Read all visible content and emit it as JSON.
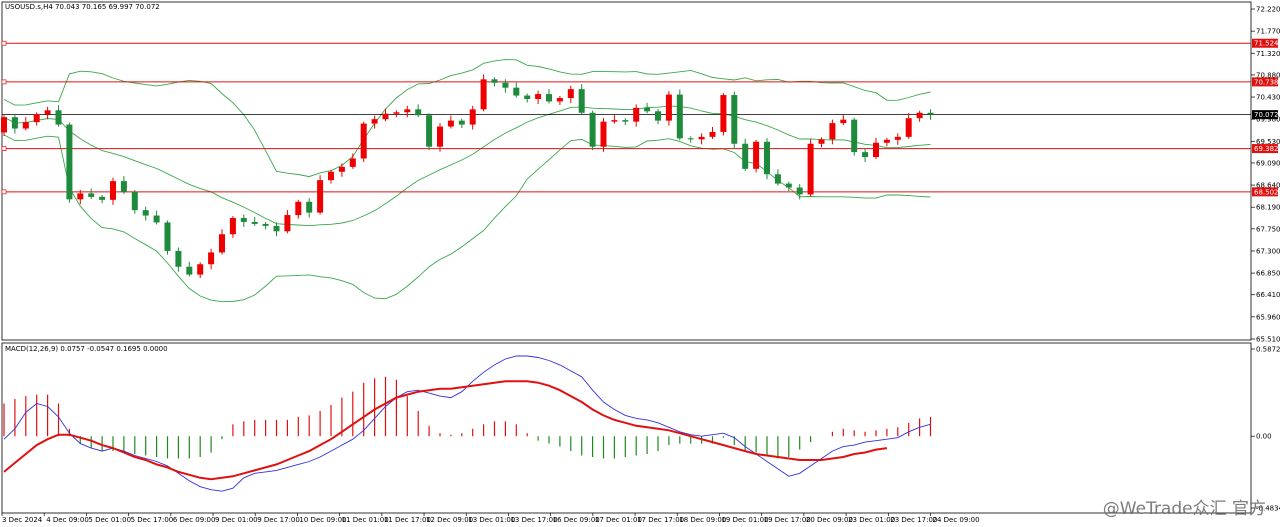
{
  "chart_data": {
    "type": "candlestick",
    "symbol_header": "USOUSD.s,H4  70.043 70.165 69.997 70.072",
    "price_axis_ticks": [
      "72.220",
      "71.770",
      "71.320",
      "70.880",
      "70.430",
      "69.980",
      "69.530",
      "69.090",
      "68.640",
      "68.190",
      "67.750",
      "67.300",
      "66.850",
      "66.410",
      "65.960",
      "65.510"
    ],
    "price_range": [
      65.51,
      72.22
    ],
    "current_price": {
      "label": "70.072",
      "value": 70.072
    },
    "horizontal_levels": [
      {
        "label": "71.524",
        "value": 71.524
      },
      {
        "label": "70.738",
        "value": 70.738
      },
      {
        "label": "69.382",
        "value": 69.382
      },
      {
        "label": "68.502",
        "value": 68.502
      }
    ],
    "time_labels": [
      "3 Dec 2024",
      "4 Dec 09:00",
      "5 Dec 01:00",
      "5 Dec 17:00",
      "6 Dec 09:00",
      "9 Dec 01:00",
      "9 Dec 17:00",
      "10 Dec 09:00",
      "11 Dec 01:00",
      "11 Dec 17:00",
      "12 Dec 09:00",
      "13 Dec 01:00",
      "13 Dec 17:00",
      "16 Dec 09:00",
      "17 Dec 01:00",
      "17 Dec 17:00",
      "18 Dec 09:00",
      "19 Dec 01:00",
      "19 Dec 17:00",
      "20 Dec 09:00",
      "23 Dec 01:00",
      "23 Dec 17:00",
      "24 Dec 09:00"
    ],
    "closes": [
      70.02,
      69.79,
      69.92,
      70.08,
      70.16,
      69.87,
      68.35,
      68.47,
      68.4,
      68.34,
      68.72,
      68.5,
      68.13,
      68.02,
      67.88,
      67.3,
      66.98,
      66.82,
      67.03,
      67.27,
      67.64,
      67.97,
      67.89,
      67.85,
      67.81,
      67.7,
      68.03,
      68.3,
      68.08,
      68.74,
      68.91,
      69.01,
      69.18,
      69.89,
      69.98,
      70.09,
      70.12,
      70.18,
      70.06,
      69.42,
      69.83,
      69.95,
      69.87,
      70.18,
      70.79,
      70.72,
      70.62,
      70.46,
      70.39,
      70.49,
      70.34,
      70.41,
      70.59,
      70.11,
      69.42,
      69.93,
      69.96,
      69.93,
      70.21,
      70.14,
      69.95,
      70.48,
      69.59,
      69.57,
      69.62,
      69.72,
      70.47,
      69.48,
      68.97,
      69.52,
      68.86,
      68.67,
      68.59,
      68.45,
      69.48,
      69.57,
      69.9,
      69.97,
      69.31,
      69.21,
      69.5,
      69.56,
      69.62,
      70.0,
      70.11,
      70.07
    ],
    "opens": [
      69.71,
      70.02,
      69.79,
      69.92,
      70.08,
      70.16,
      69.87,
      68.35,
      68.47,
      68.4,
      68.34,
      68.72,
      68.5,
      68.13,
      68.02,
      67.88,
      67.3,
      66.98,
      66.82,
      67.03,
      67.27,
      67.64,
      67.97,
      67.89,
      67.85,
      67.81,
      67.7,
      68.03,
      68.3,
      68.08,
      68.74,
      68.91,
      69.01,
      69.18,
      69.89,
      69.98,
      70.09,
      70.12,
      70.18,
      70.06,
      69.42,
      69.83,
      69.95,
      69.87,
      70.18,
      70.79,
      70.72,
      70.62,
      70.46,
      70.39,
      70.49,
      70.34,
      70.41,
      70.59,
      70.11,
      69.42,
      69.93,
      69.96,
      69.93,
      70.21,
      70.14,
      69.95,
      70.48,
      69.59,
      69.57,
      69.62,
      69.72,
      70.47,
      69.48,
      68.97,
      69.52,
      68.86,
      68.67,
      68.59,
      68.45,
      69.48,
      69.57,
      69.9,
      69.97,
      69.31,
      69.21,
      69.5,
      69.56,
      69.62,
      70.0,
      70.11
    ],
    "macd": {
      "label": "MACD(12,26,9) 0.0757 -0.0547 0.1695 0.0000",
      "axis_ticks": [
        "0.5872",
        "0.00",
        "-0.4834"
      ],
      "range": [
        -0.4834,
        0.5872
      ],
      "histogram": [
        0.22,
        0.25,
        0.27,
        0.28,
        0.28,
        0.22,
        0.05,
        -0.05,
        -0.08,
        -0.1,
        -0.1,
        -0.11,
        -0.12,
        -0.13,
        -0.14,
        -0.15,
        -0.15,
        -0.15,
        -0.14,
        -0.11,
        -0.02,
        0.08,
        0.1,
        0.11,
        0.11,
        0.11,
        0.11,
        0.13,
        0.14,
        0.17,
        0.21,
        0.26,
        0.3,
        0.36,
        0.39,
        0.4,
        0.38,
        0.27,
        0.17,
        0.07,
        0.02,
        0.01,
        0.02,
        0.05,
        0.08,
        0.1,
        0.1,
        0.08,
        0.02,
        -0.03,
        -0.05,
        -0.07,
        -0.1,
        -0.13,
        -0.14,
        -0.15,
        -0.15,
        -0.14,
        -0.13,
        -0.12,
        -0.1,
        -0.06,
        -0.05,
        -0.05,
        -0.05,
        -0.05,
        -0.01,
        -0.06,
        -0.1,
        -0.11,
        -0.13,
        -0.15,
        -0.14,
        -0.09,
        -0.04,
        0.0,
        0.03,
        0.05,
        0.04,
        0.03,
        0.04,
        0.05,
        0.06,
        0.09,
        0.12,
        0.13
      ],
      "macd_line": [
        -0.02,
        0.05,
        0.16,
        0.22,
        0.2,
        0.13,
        0.02,
        -0.05,
        -0.08,
        -0.1,
        -0.08,
        -0.1,
        -0.13,
        -0.15,
        -0.17,
        -0.2,
        -0.25,
        -0.3,
        -0.34,
        -0.36,
        -0.37,
        -0.35,
        -0.28,
        -0.25,
        -0.24,
        -0.23,
        -0.21,
        -0.19,
        -0.17,
        -0.14,
        -0.1,
        -0.06,
        -0.02,
        0.04,
        0.12,
        0.2,
        0.26,
        0.3,
        0.31,
        0.29,
        0.27,
        0.26,
        0.3,
        0.37,
        0.43,
        0.48,
        0.52,
        0.54,
        0.54,
        0.53,
        0.51,
        0.48,
        0.44,
        0.4,
        0.31,
        0.23,
        0.18,
        0.14,
        0.12,
        0.11,
        0.09,
        0.06,
        0.03,
        0.01,
        0.0,
        0.01,
        0.02,
        -0.01,
        -0.07,
        -0.12,
        -0.17,
        -0.22,
        -0.27,
        -0.25,
        -0.2,
        -0.15,
        -0.1,
        -0.07,
        -0.06,
        -0.04,
        -0.03,
        -0.02,
        -0.01,
        0.03,
        0.06,
        0.08
      ],
      "signal_line": [
        -0.24,
        -0.18,
        -0.12,
        -0.06,
        -0.02,
        0.01,
        0.01,
        -0.01,
        -0.03,
        -0.06,
        -0.08,
        -0.11,
        -0.14,
        -0.16,
        -0.19,
        -0.21,
        -0.24,
        -0.26,
        -0.28,
        -0.29,
        -0.28,
        -0.27,
        -0.25,
        -0.23,
        -0.21,
        -0.19,
        -0.16,
        -0.13,
        -0.1,
        -0.06,
        -0.02,
        0.03,
        0.08,
        0.13,
        0.18,
        0.22,
        0.26,
        0.28,
        0.3,
        0.31,
        0.32,
        0.32,
        0.33,
        0.34,
        0.35,
        0.36,
        0.37,
        0.37,
        0.37,
        0.36,
        0.34,
        0.31,
        0.27,
        0.23,
        0.18,
        0.14,
        0.11,
        0.09,
        0.07,
        0.06,
        0.05,
        0.04,
        0.02,
        0.0,
        -0.02,
        -0.04,
        -0.06,
        -0.08,
        -0.1,
        -0.12,
        -0.13,
        -0.14,
        -0.15,
        -0.16,
        -0.16,
        -0.16,
        -0.15,
        -0.14,
        -0.12,
        -0.11,
        -0.09,
        -0.08
      ]
    }
  },
  "colors": {
    "bull": "#ef0000",
    "bear": "#1e8a3c",
    "band": "#3aa84a",
    "level": "#e01010",
    "macd_up": "#e01010",
    "macd_down": "#1e8a1e",
    "macd_line": "#3030e0",
    "signal_line": "#e01010",
    "current_line": "#000000"
  },
  "watermark": "@WeTrade众汇 官方"
}
